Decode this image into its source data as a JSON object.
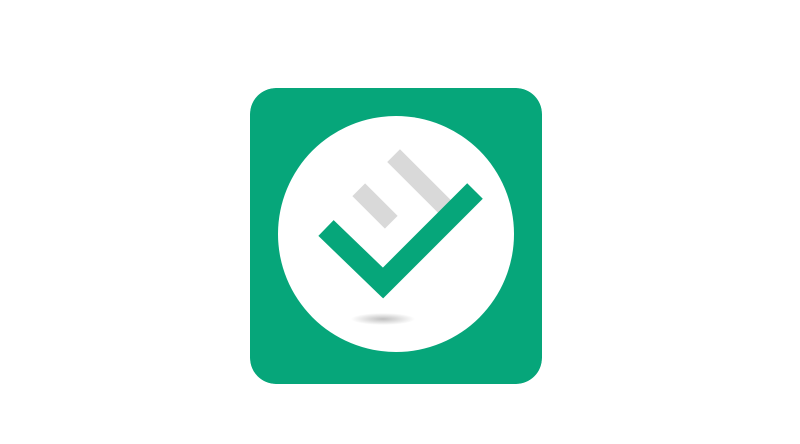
{
  "icon": {
    "name": "checklist-app-icon",
    "tile_color": "#06A67A",
    "circle_color": "#FFFFFF",
    "check_color": "#06A67A",
    "bar_color": "#D9D9D9",
    "shadow_color": "#9E9E9E"
  }
}
